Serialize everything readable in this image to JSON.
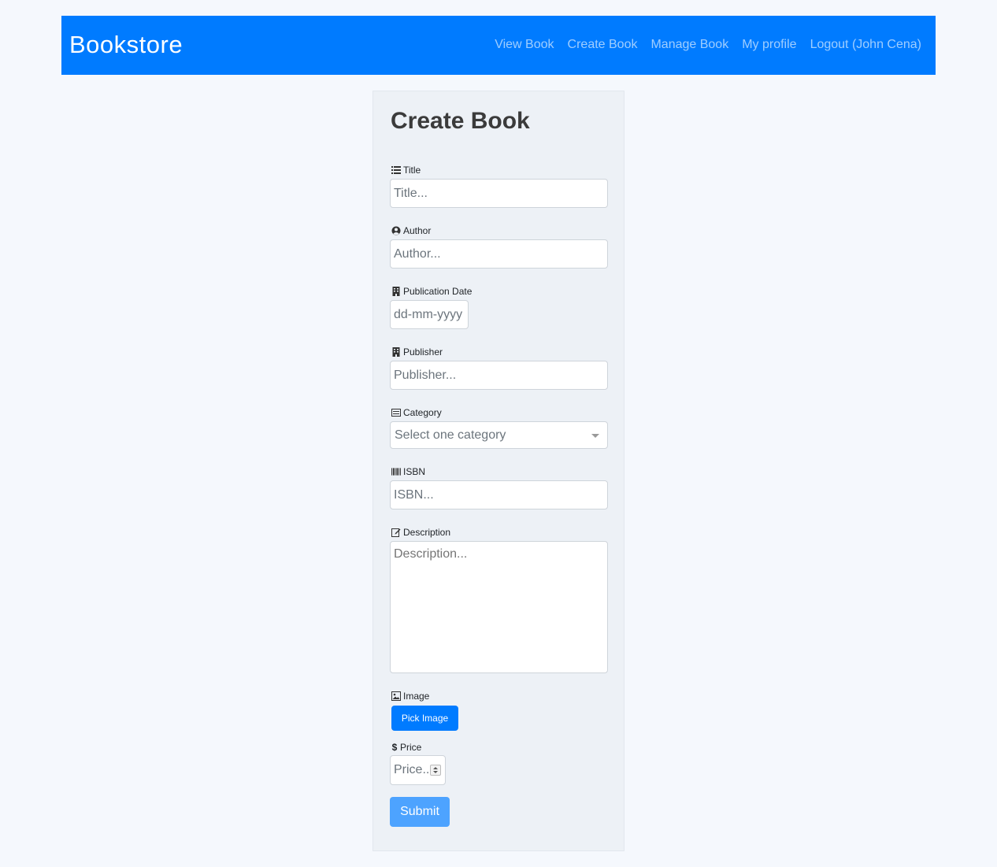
{
  "navbar": {
    "brand": "Bookstore",
    "links": [
      "View Book",
      "Create Book",
      "Manage Book",
      "My profile",
      "Logout (John Cena)"
    ],
    "bg_color": "#007bff"
  },
  "form": {
    "title": "Create Book",
    "fields": {
      "title": {
        "label": "Title",
        "placeholder": "Title...",
        "icon": "list-icon"
      },
      "author": {
        "label": "Author",
        "placeholder": "Author...",
        "icon": "user-circle-icon"
      },
      "publication_date": {
        "label": "Publication Date",
        "placeholder": "dd-mm-yyyy",
        "icon": "building-icon"
      },
      "publisher": {
        "label": "Publisher",
        "placeholder": "Publisher...",
        "icon": "building-icon"
      },
      "category": {
        "label": "Category",
        "placeholder": "Select one category",
        "icon": "card-list-icon"
      },
      "isbn": {
        "label": "ISBN",
        "placeholder": "ISBN...",
        "icon": "barcode-icon"
      },
      "description": {
        "label": "Description",
        "placeholder": "Description...",
        "icon": "edit-icon"
      },
      "image": {
        "label": "Image",
        "button_label": "Pick Image",
        "icon": "image-icon"
      },
      "price": {
        "label": "Price",
        "placeholder": "Price...",
        "icon": "dollar-icon"
      }
    },
    "submit_label": "Submit"
  }
}
